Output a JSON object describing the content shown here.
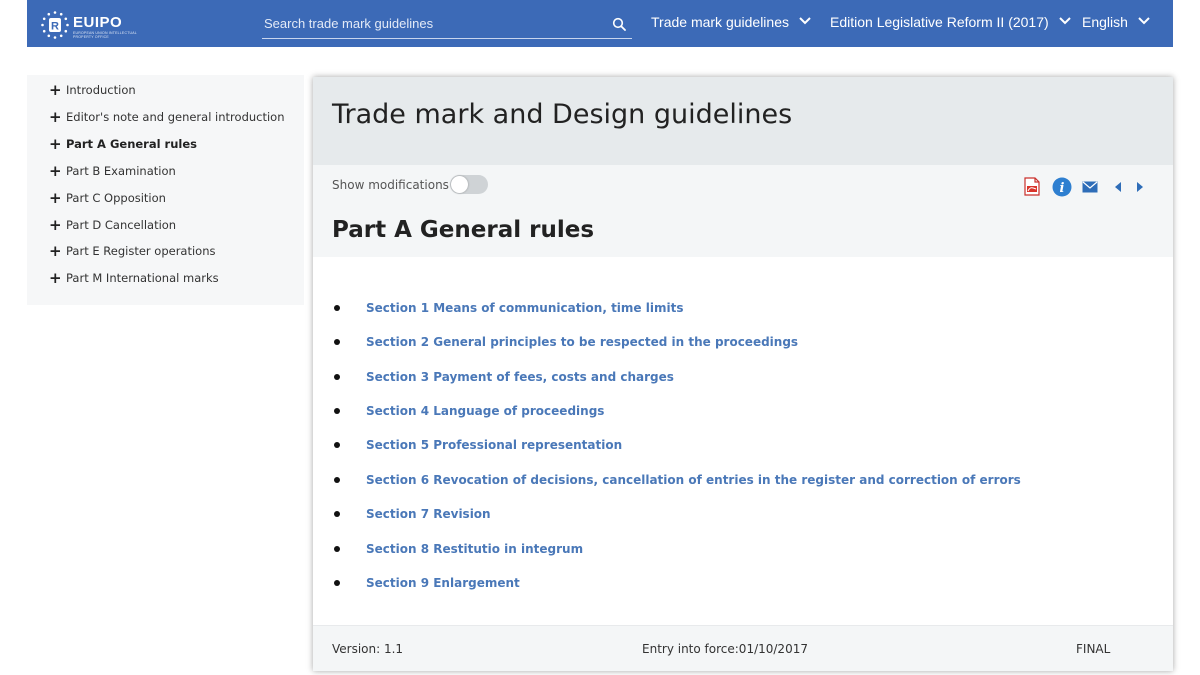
{
  "header": {
    "logo_text": "EUIPO",
    "logo_sub": "EUROPEAN UNION INTELLECTUAL PROPERTY OFFICE",
    "search_placeholder": "Search trade mark guidelines",
    "nav": [
      "Trade mark guidelines",
      "Edition Legislative Reform II (2017)",
      "English"
    ]
  },
  "sidebar": {
    "items": [
      {
        "label": "Introduction",
        "active": false
      },
      {
        "label": "Editor's note and general introduction",
        "active": false
      },
      {
        "label": "Part A General rules",
        "active": true
      },
      {
        "label": "Part B Examination",
        "active": false
      },
      {
        "label": "Part C Opposition",
        "active": false
      },
      {
        "label": "Part D Cancellation",
        "active": false
      },
      {
        "label": "Part E Register operations",
        "active": false
      },
      {
        "label": "Part M International marks",
        "active": false
      }
    ]
  },
  "main": {
    "title": "Trade mark and Design guidelines",
    "show_modifications_label": "Show modifications",
    "show_modifications_on": false,
    "section_title": "Part A General rules",
    "sections": [
      "Section 1 Means of communication, time limits",
      "Section 2 General principles to be respected in the proceedings",
      "Section 3 Payment of fees, costs and charges",
      "Section 4 Language of proceedings",
      "Section 5 Professional representation",
      "Section 6 Revocation of decisions, cancellation of entries in the register and correction of errors",
      "Section 7 Revision",
      "Section 8 Restitutio in integrum",
      "Section 9 Enlargement"
    ],
    "footer": {
      "version": "Version: 1.1",
      "entry": "Entry into force:01/10/2017",
      "status": "FINAL"
    }
  },
  "colors": {
    "header_bg": "#3c6ab7",
    "link": "#4a78b8",
    "card_head_bg": "#e6eaec",
    "sidebar_bg": "#f6f7f8"
  }
}
